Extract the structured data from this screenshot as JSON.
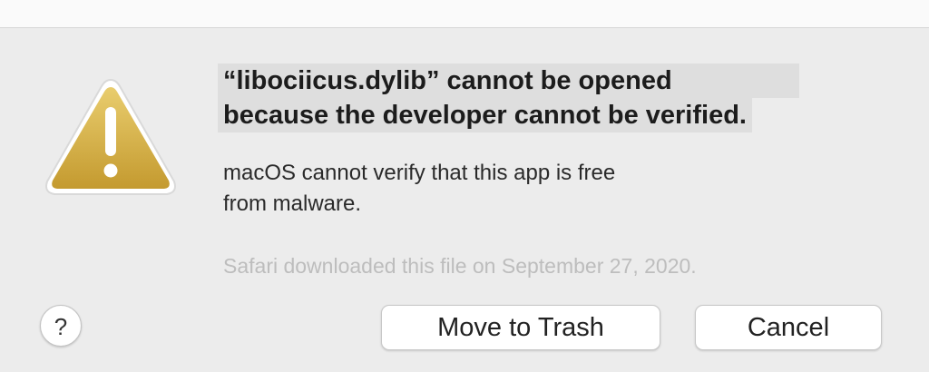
{
  "dialog": {
    "title_line_1": "“libociicus.dylib” cannot be opened",
    "title_line_2": "because the developer cannot be verified.",
    "message_line_1": "macOS cannot verify that this app is free",
    "message_line_2": "from malware.",
    "source_note": "Safari downloaded this file on September 27, 2020.",
    "icon": "warning-triangle-icon",
    "icon_color": "#d7b34a"
  },
  "buttons": {
    "help_label": "?",
    "move_to_trash_label": "Move to Trash",
    "cancel_label": "Cancel"
  },
  "colors": {
    "background": "#ececec",
    "title_highlight": "#dedede",
    "muted_text": "#bdbdbd"
  }
}
